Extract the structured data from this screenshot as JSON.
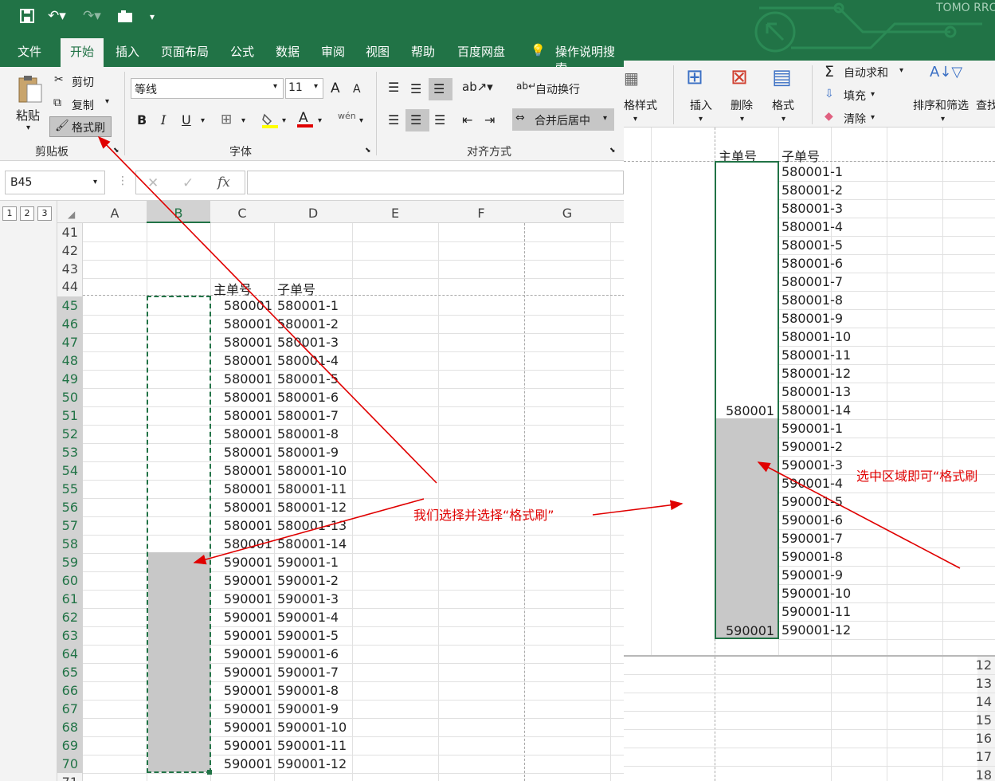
{
  "quick_access": {
    "save_icon": "save-icon",
    "undo_icon": "undo-icon",
    "redo_icon": "redo-icon",
    "camera_icon": "camera-icon",
    "customize": "▾"
  },
  "tabs": [
    "文件",
    "开始",
    "插入",
    "页面布局",
    "公式",
    "数据",
    "审阅",
    "视图",
    "帮助",
    "百度网盘"
  ],
  "tell_me": "操作说明搜索",
  "clipboard": {
    "paste": "粘贴",
    "cut": "剪切",
    "copy": "复制",
    "format_painter": "格式刷",
    "group": "剪贴板"
  },
  "font": {
    "name": "等线",
    "size": "11",
    "group": "字体",
    "grow": "A",
    "shrink": "A",
    "bold": "B",
    "italic": "I",
    "underline": "U",
    "phonetic": "wén"
  },
  "alignment": {
    "wrap": "自动换行",
    "merge": "合并后居中",
    "group": "对齐方式"
  },
  "right_ribbon": {
    "cell_style": "格样式",
    "insert": "插入",
    "delete": "删除",
    "format": "格式",
    "autosum": "自动求和",
    "fill": "填充",
    "clear": "清除",
    "sort": "排序和筛选",
    "find": "查找",
    "brand": "TOMO RRO"
  },
  "formula_bar": {
    "name_box": "B45",
    "fx": "fx",
    "cancel": "✕",
    "enter": "✓"
  },
  "outline_levels": [
    "1",
    "2",
    "3"
  ],
  "columns": [
    "A",
    "B",
    "C",
    "D",
    "E",
    "F",
    "G"
  ],
  "header_row": {
    "row": "44",
    "c": "主单号",
    "d": "子单号"
  },
  "rows": [
    {
      "n": "41",
      "c": "",
      "d": ""
    },
    {
      "n": "42",
      "c": "",
      "d": ""
    },
    {
      "n": "43",
      "c": "",
      "d": ""
    },
    {
      "n": "45",
      "c": "580001",
      "d": "580001-1"
    },
    {
      "n": "46",
      "c": "580001",
      "d": "580001-2"
    },
    {
      "n": "47",
      "c": "580001",
      "d": "580001-3"
    },
    {
      "n": "48",
      "c": "580001",
      "d": "580001-4"
    },
    {
      "n": "49",
      "c": "580001",
      "d": "580001-5"
    },
    {
      "n": "50",
      "c": "580001",
      "d": "580001-6"
    },
    {
      "n": "51",
      "c": "580001",
      "d": "580001-7"
    },
    {
      "n": "52",
      "c": "580001",
      "d": "580001-8"
    },
    {
      "n": "53",
      "c": "580001",
      "d": "580001-9"
    },
    {
      "n": "54",
      "c": "580001",
      "d": "580001-10"
    },
    {
      "n": "55",
      "c": "580001",
      "d": "580001-11"
    },
    {
      "n": "56",
      "c": "580001",
      "d": "580001-12"
    },
    {
      "n": "57",
      "c": "580001",
      "d": "580001-13"
    },
    {
      "n": "58",
      "c": "580001",
      "d": "580001-14"
    },
    {
      "n": "59",
      "c": "590001",
      "d": "590001-1"
    },
    {
      "n": "60",
      "c": "590001",
      "d": "590001-2"
    },
    {
      "n": "61",
      "c": "590001",
      "d": "590001-3"
    },
    {
      "n": "62",
      "c": "590001",
      "d": "590001-4"
    },
    {
      "n": "63",
      "c": "590001",
      "d": "590001-5"
    },
    {
      "n": "64",
      "c": "590001",
      "d": "590001-6"
    },
    {
      "n": "65",
      "c": "590001",
      "d": "590001-7"
    },
    {
      "n": "66",
      "c": "590001",
      "d": "590001-8"
    },
    {
      "n": "67",
      "c": "590001",
      "d": "590001-9"
    },
    {
      "n": "68",
      "c": "590001",
      "d": "590001-10"
    },
    {
      "n": "69",
      "c": "590001",
      "d": "590001-11"
    },
    {
      "n": "70",
      "c": "590001",
      "d": "590001-12"
    },
    {
      "n": "71",
      "c": "",
      "d": ""
    }
  ],
  "right_sheet": {
    "col_c_header": "主单号",
    "col_d_header": "子单号",
    "merged_top": "580001",
    "merged_bottom": "590001",
    "sub_ids": [
      "580001-1",
      "580001-2",
      "580001-3",
      "580001-4",
      "580001-5",
      "580001-6",
      "580001-7",
      "580001-8",
      "580001-9",
      "580001-10",
      "580001-11",
      "580001-12",
      "580001-13",
      "580001-14",
      "590001-1",
      "590001-2",
      "590001-3",
      "590001-4",
      "590001-5",
      "590001-6",
      "590001-7",
      "590001-8",
      "590001-9",
      "590001-10",
      "590001-11",
      "590001-12"
    ],
    "row_nums": [
      "12",
      "13",
      "14",
      "15",
      "16",
      "17",
      "18"
    ]
  },
  "annotations": {
    "left": "我们选择并选择“格式刷”",
    "right": "选中区域即可“格式刷"
  },
  "colors": {
    "excel_green": "#217346",
    "selection": "#c8c8c8",
    "annotation": "#e00000"
  }
}
